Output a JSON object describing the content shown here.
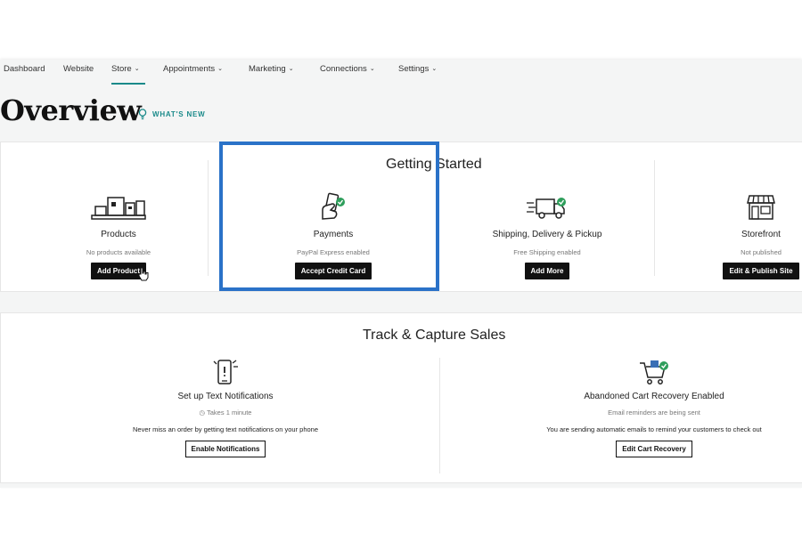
{
  "nav": {
    "items": [
      {
        "label": "Dashboard",
        "chevron": false
      },
      {
        "label": "Website",
        "chevron": false
      },
      {
        "label": "Store",
        "chevron": true,
        "active": true
      },
      {
        "label": "Appointments",
        "chevron": true
      },
      {
        "label": "Marketing",
        "chevron": true
      },
      {
        "label": "Connections",
        "chevron": true
      },
      {
        "label": "Settings",
        "chevron": true
      }
    ]
  },
  "header": {
    "title": "Overview",
    "whats_new": "WHAT'S NEW"
  },
  "getting_started": {
    "title": "Getting Started",
    "items": [
      {
        "label": "Products",
        "status": "No products available",
        "button": "Add Product",
        "icon": "products-icon"
      },
      {
        "label": "Payments",
        "status": "PayPal Express enabled",
        "button": "Accept Credit Card",
        "icon": "payment-card-check-icon"
      },
      {
        "label": "Shipping, Delivery & Pickup",
        "status": "Free Shipping enabled",
        "button": "Add More",
        "icon": "delivery-truck-check-icon"
      },
      {
        "label": "Storefront",
        "status": "Not published",
        "button": "Edit & Publish Site",
        "icon": "storefront-icon"
      }
    ]
  },
  "track_capture": {
    "title": "Track & Capture Sales",
    "items": [
      {
        "label": "Set up Text Notifications",
        "status": "Takes 1 minute",
        "description": "Never miss an order by getting text notifications on your phone",
        "button": "Enable Notifications",
        "icon": "phone-alert-icon"
      },
      {
        "label": "Abandoned Cart Recovery Enabled",
        "status": "Email reminders are being sent",
        "description": "You are sending automatic emails to remind your customers to check out",
        "button": "Edit Cart Recovery",
        "icon": "cart-check-icon"
      }
    ]
  },
  "colors": {
    "accent": "#1a8a8a",
    "highlight": "#2a72c8",
    "check": "#2e9e5b",
    "button": "#111111"
  }
}
